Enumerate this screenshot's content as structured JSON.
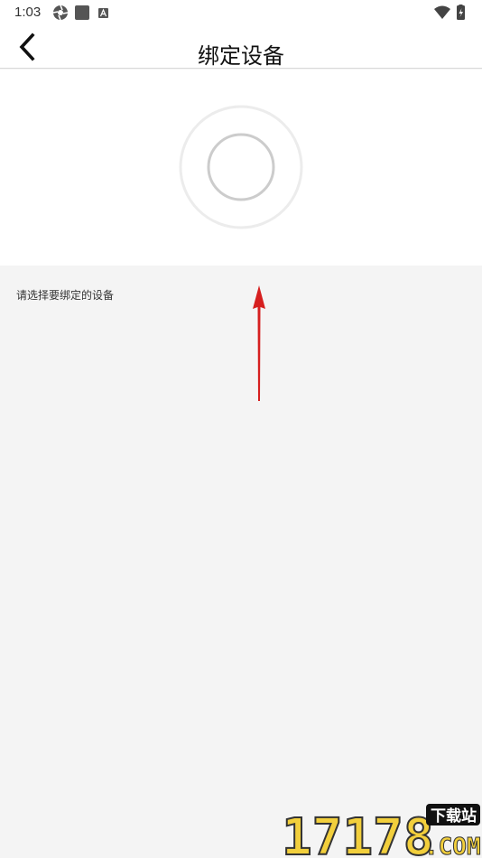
{
  "status_bar": {
    "time": "1:03",
    "icons_left": [
      "aperture-icon",
      "square-icon",
      "a-badge-icon"
    ],
    "icons_right": [
      "wifi-icon",
      "battery-icon"
    ]
  },
  "header": {
    "title": "绑定设备",
    "back_icon": "chevron-left-icon"
  },
  "scan": {
    "ring_outer_color": "#ececec",
    "ring_inner_color": "#cccccc"
  },
  "prompt": {
    "text": "请选择要绑定的设备"
  },
  "annotation": {
    "arrow_color": "#d61f1f"
  },
  "watermark": {
    "text": "17178",
    "badge": "下载站",
    "suffix": ".COM"
  }
}
